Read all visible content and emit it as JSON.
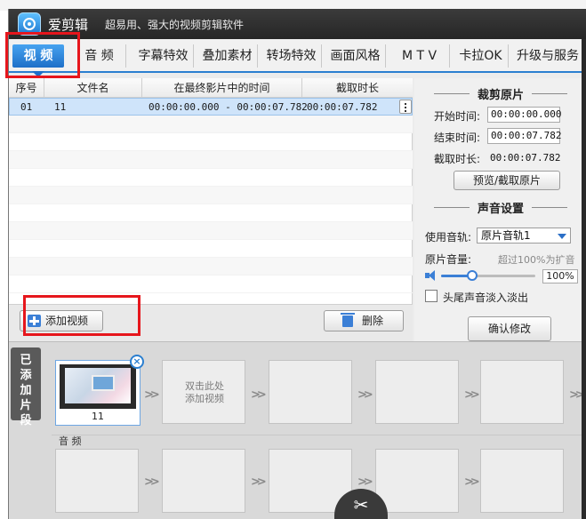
{
  "window": {
    "app_name": "爱剪辑",
    "app_subtitle": "超易用、强大的视频剪辑软件"
  },
  "menu": {
    "tabs": [
      {
        "label": "视 频",
        "active": true
      },
      {
        "label": "音 频"
      },
      {
        "label": "字幕特效"
      },
      {
        "label": "叠加素材"
      },
      {
        "label": "转场特效"
      },
      {
        "label": "画面风格"
      },
      {
        "label": "M T V"
      },
      {
        "label": "卡拉OK"
      },
      {
        "label": "升级与服务"
      }
    ]
  },
  "table": {
    "headers": [
      "序号",
      "文件名",
      "在最终影片中的时间",
      "截取时长"
    ],
    "rows": [
      {
        "index": "01",
        "file": "11",
        "time_range": "00:00:00.000 - 00:00:07.782",
        "duration": "00:00:07.782",
        "selected": true
      }
    ]
  },
  "toolbar": {
    "add_video": "添加视频",
    "delete": "删除"
  },
  "clip_panel": {
    "title": "裁剪原片",
    "start_label": "开始时间:",
    "start_value": "00:00:00.000",
    "end_label": "结束时间:",
    "end_value": "00:00:07.782",
    "duration_label": "截取时长:",
    "duration_value": "00:00:07.782",
    "preview_button": "预览/截取原片"
  },
  "sound_panel": {
    "title": "声音设置",
    "track_label": "使用音轨:",
    "track_value": "原片音轨1",
    "volume_label": "原片音量:",
    "volume_hint": "超过100%为扩音",
    "volume_value": "100%",
    "volume_level": 0.33,
    "fade_label": "头尾声音淡入淡出",
    "confirm_button": "确认修改"
  },
  "storyboard": {
    "side_tab": [
      "已",
      "添",
      "加",
      "片",
      "段"
    ],
    "clip_name": "11",
    "empty_slot_text": "双击此处\n添加视频",
    "audio_label": "音 频"
  },
  "colors": {
    "accent": "#2b7fd0",
    "highlight": "#e6161c",
    "titlebar": "#2e2e2e"
  }
}
